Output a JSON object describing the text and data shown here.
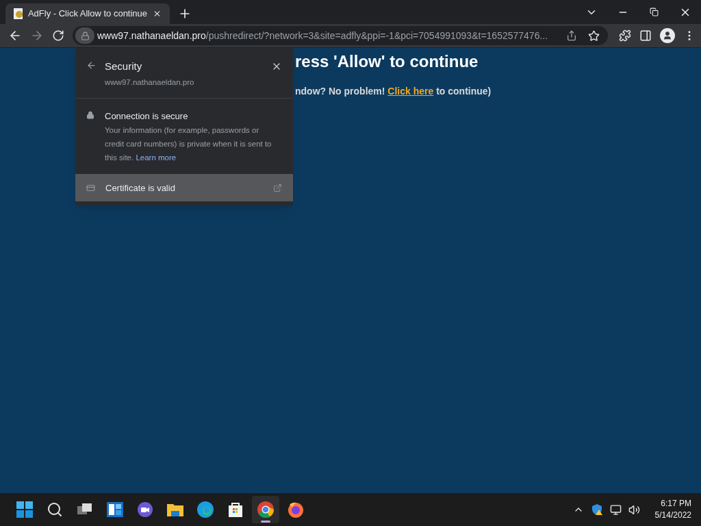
{
  "tabs": [
    {
      "title": "AdFly - Click Allow to continue",
      "selected": true
    }
  ],
  "address_bar": {
    "host": "www97.nathanaeldan.pro",
    "path": "/pushredirect/?network=3&site=adfly&ppi=-1&pci=7054991093&t=1652577476..."
  },
  "page": {
    "heading": "ress 'Allow' to continue",
    "text_before": "ndow? No problem!",
    "link": "Click here",
    "text_after": "to continue)"
  },
  "security_popup": {
    "title": "Security",
    "host": "www97.nathanaeldan.pro",
    "connection_title": "Connection is secure",
    "connection_text": "Your information (for example, passwords or credit card numbers) is private when it is sent to this site.",
    "learn_more": "Learn more",
    "certificate": "Certificate is valid"
  },
  "taskbar": {
    "apps": [
      {
        "kind": "start",
        "active": false
      },
      {
        "kind": "search",
        "active": false
      },
      {
        "kind": "taskview",
        "active": false
      },
      {
        "kind": "widgets",
        "active": false
      },
      {
        "kind": "chat",
        "active": false
      },
      {
        "kind": "explorer",
        "active": false
      },
      {
        "kind": "edge",
        "active": false
      },
      {
        "kind": "store",
        "active": false
      },
      {
        "kind": "chrome",
        "active": true
      },
      {
        "kind": "firefox",
        "active": false
      }
    ],
    "time": "6:17 PM",
    "date": "5/14/2022"
  }
}
